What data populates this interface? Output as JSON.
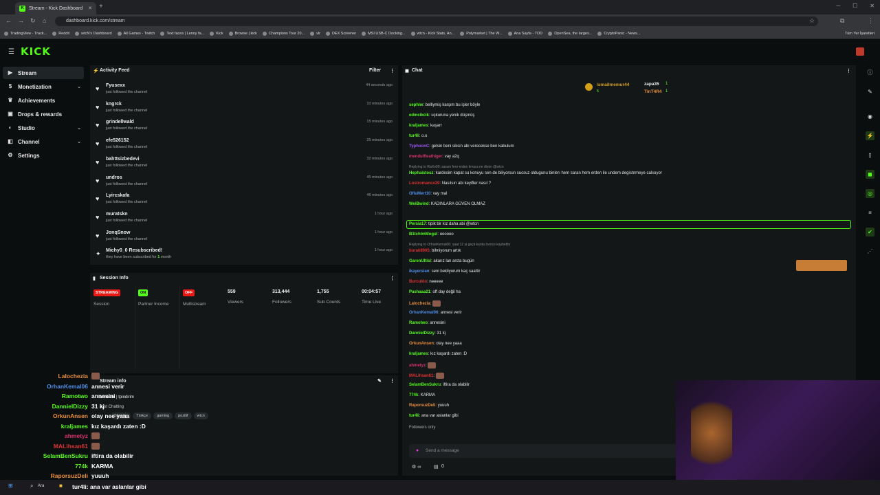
{
  "browser": {
    "tab_title": "Stream - Kick Dashboard",
    "url": "dashboard.kick.com/stream",
    "bookmarks": [
      "TradingView - Track...",
      "Reddit",
      "wtcN's Dashboard",
      "All Games - Twitch",
      "Text faces | Lenny fa...",
      "Kick",
      "Browse | kick",
      "Champions Tour 20...",
      "vlr",
      "DEX Screener",
      "MSI USB-C Docking...",
      "wtcn - Kick Stats, An...",
      "Polymarket | The W...",
      "Ana Sayfa - TOD",
      "OpenSea, the larges...",
      "CryptoPanic - News..."
    ],
    "all_bookmarks": "Tüm Yer İşaretleri"
  },
  "header": {
    "logo": "KICK"
  },
  "sidebar": {
    "items": [
      {
        "label": "Stream",
        "icon": "video-icon",
        "chevron": false,
        "active": true
      },
      {
        "label": "Monetization",
        "icon": "money-icon",
        "chevron": true
      },
      {
        "label": "Achievements",
        "icon": "trophy-icon",
        "chevron": false
      },
      {
        "label": "Drops & rewards",
        "icon": "gift-icon",
        "chevron": false
      },
      {
        "label": "Studio",
        "icon": "studio-icon",
        "chevron": true
      },
      {
        "label": "Channel",
        "icon": "channel-icon",
        "chevron": true
      },
      {
        "label": "Settings",
        "icon": "gear-icon",
        "chevron": false
      }
    ]
  },
  "activity": {
    "title": "Activity Feed",
    "filter": "Filter",
    "rows": [
      {
        "name": "Fyusexx",
        "sub": "just followed the channel",
        "time": "44 seconds ago"
      },
      {
        "name": "kngrck",
        "sub": "just followed the channel",
        "time": "10 minutes ago"
      },
      {
        "name": "grindellwald",
        "sub": "just followed the channel",
        "time": "15 minutes ago"
      },
      {
        "name": "efe526152",
        "sub": "just followed the channel",
        "time": "25 minutes ago"
      },
      {
        "name": "bahttsizbedevi",
        "sub": "just followed the channel",
        "time": "32 minutes ago"
      },
      {
        "name": "undros",
        "sub": "just followed the channel",
        "time": "45 minutes ago"
      },
      {
        "name": "Lyircskafa",
        "sub": "just followed the channel",
        "time": "46 minutes ago"
      },
      {
        "name": "muratskn",
        "sub": "just followed the channel",
        "time": "1 hour ago"
      },
      {
        "name": "JonqSnow",
        "sub": "just followed the channel",
        "time": "1 hour ago"
      },
      {
        "name": "Michy0_0 Resubscribed!",
        "sub_prefix": "they have been subscribed for ",
        "sub_num": "1",
        "sub_suffix": " month",
        "time": "1 hour ago"
      }
    ]
  },
  "session": {
    "title": "Session Info",
    "stats": [
      {
        "badge": "STREAMING",
        "badge_color": "#e91916",
        "label": "Session"
      },
      {
        "badge": "ON",
        "badge_color": "#53fc18",
        "label": "Partner Income"
      },
      {
        "badge": "OFF",
        "badge_color": "#e91916",
        "label": "Multistream"
      },
      {
        "value": "559",
        "label": "Viewers"
      },
      {
        "value": "313,444",
        "label": "Followers"
      },
      {
        "value": "1,755",
        "label": "Sub Counts"
      },
      {
        "value": "00:04:57",
        "label": "Time Live"
      }
    ]
  },
  "stream_info": {
    "title": "Stream info",
    "stream_title": "annesini | tpindirim",
    "category": "Just Chatting",
    "tags": [
      "Shooter",
      "Türkçe",
      "gaming",
      "pozitif",
      "wtcn"
    ]
  },
  "overlay_chat": [
    {
      "user": "Lalochezia",
      "color": "#e88f3d",
      "msg": ""
    },
    {
      "user": "OrhanKemal06",
      "color": "#4f8fe8",
      "msg": "annesi verir"
    },
    {
      "user": "Ramotwo",
      "color": "#53fc18",
      "msg": "annesini"
    },
    {
      "user": "DannielDizzy",
      "color": "#53fc18",
      "msg": "31 kj"
    },
    {
      "user": "OrkunAnsen",
      "color": "#e88f3d",
      "msg": "olay nee yaaa"
    },
    {
      "user": "kraljames",
      "color": "#53fc18",
      "msg": "kız kaşardı zaten :D"
    },
    {
      "user": "ahmetyz",
      "color": "#d6336c",
      "msg": ""
    },
    {
      "user": "MALihsan61",
      "color": "#e03131",
      "msg": ""
    },
    {
      "user": "SelamBenSukru",
      "color": "#53fc18",
      "msg": "iftira da olabilir"
    },
    {
      "user": "774k",
      "color": "#53fc18",
      "msg": "KARMA"
    },
    {
      "user": "RaporsuzDeli",
      "color": "#e88f3d",
      "msg": "yuuuh"
    }
  ],
  "overlay_last": "tur4li: ana var aslanlar gibi",
  "chat": {
    "title": "Chat",
    "top_users": [
      {
        "name": "ismailmemur44",
        "count": "5"
      },
      {
        "name": "zapa35",
        "count": "1"
      },
      {
        "name": "TinT4R4",
        "count": "1"
      }
    ],
    "lines": [
      {
        "type": "msg",
        "user": "sephiw",
        "color": "#53fc18",
        "text": "belliymiş karşım bu işler böyle"
      },
      {
        "type": "msg",
        "user": "edmcikcik",
        "color": "#53fc18",
        "text": "uçkuruna yenik düşmüş"
      },
      {
        "type": "msg",
        "user": "kraljames",
        "color": "#53fc18",
        "text": "kaşarr"
      },
      {
        "type": "msg",
        "user": "tur4li",
        "color": "#53fc18",
        "text": "o.o"
      },
      {
        "type": "msg",
        "user": "TyphoonC",
        "color": "#9b59f5",
        "text": "gelsin beni siksin abi verecekse ben kabulum"
      },
      {
        "type": "msg",
        "user": "mendulfleathiger",
        "color": "#d6336c",
        "text": "vay a2q"
      },
      {
        "type": "reply",
        "text": "Replying to RaXo00: saram fero erden timura ne diyon @wtcn"
      },
      {
        "type": "msg",
        "user": "Hephaistosz",
        "color": "#53fc18",
        "text": "kardesim kapat su konuyu sen de biliyorsun sucsuz oldugunu binlerı hem saran hem erden ile undem degistırmeye calısıyor"
      },
      {
        "type": "msg",
        "user": "Lostromance39",
        "color": "#e03131",
        "text": "Nasılsın abi keyifler nasıl ?"
      },
      {
        "type": "msg",
        "user": "OfluMert10",
        "color": "#4f8fe8",
        "text": "vay mal"
      },
      {
        "type": "msg",
        "user": "WeiBwind",
        "color": "#53fc18",
        "text": "KADINLARA GÜVEN OLMAZ"
      },
      {
        "type": "msg",
        "user": "Persia17",
        "color": "#53fc18",
        "text": "tipik bir kız daha abi @wtcn",
        "highlight": true
      },
      {
        "type": "msg",
        "user": "B1tchImMogul",
        "color": "#53fc18",
        "text": "oooooo"
      },
      {
        "type": "reply",
        "text": "Replying to OrhanKemal06: saat 12 yi geçti kanka bence kaybettin"
      },
      {
        "type": "msg",
        "user": "burak8905",
        "color": "#e03131",
        "text": "bilmiyorum artık"
      },
      {
        "type": "msg",
        "user": "GarenUltisi",
        "color": "#53fc18",
        "text": "akarız lan arcta bugün"
      },
      {
        "type": "msg",
        "user": "ikayersian",
        "color": "#4f8fe8",
        "text": "seni bekliyorum kaç saattir"
      },
      {
        "type": "msg",
        "user": "Burcuklo",
        "color": "#e03131",
        "text": "neeeee"
      },
      {
        "type": "msg",
        "user": "Pashaaa21",
        "color": "#53fc18",
        "text": "off day değil ha"
      },
      {
        "type": "msg",
        "user": "Lalochezia",
        "color": "#e88f3d",
        "text": ""
      },
      {
        "type": "msg",
        "user": "OrhanKemal06",
        "color": "#4f8fe8",
        "text": "annesi verir"
      },
      {
        "type": "msg",
        "user": "Ramotwo",
        "color": "#53fc18",
        "text": "annesini"
      },
      {
        "type": "msg",
        "user": "DannielDizzy",
        "color": "#53fc18",
        "text": "31 kj"
      },
      {
        "type": "msg",
        "user": "OrkunAnsen",
        "color": "#e88f3d",
        "text": "olay nee yaaa"
      },
      {
        "type": "msg",
        "user": "kraljames",
        "color": "#53fc18",
        "text": "kız kaşardı zaten :D"
      },
      {
        "type": "msg",
        "user": "ahmetyz",
        "color": "#d6336c",
        "text": ""
      },
      {
        "type": "msg",
        "user": "MALihsan61",
        "color": "#e03131",
        "text": ""
      },
      {
        "type": "msg",
        "user": "SelamBenSukru",
        "color": "#53fc18",
        "text": "iftira da olabilir"
      },
      {
        "type": "msg",
        "user": "774k",
        "color": "#53fc18",
        "text": "KARMA"
      },
      {
        "type": "msg",
        "user": "RaporsuzDeli",
        "color": "#e88f3d",
        "text": "yuuuh"
      },
      {
        "type": "msg",
        "user": "tur4li",
        "color": "#53fc18",
        "text": "ana var aslanlar gibi"
      }
    ],
    "followers_only": "Followers only",
    "input_placeholder": "Send a message",
    "points": "0"
  },
  "taskbar": {
    "search": "Ara"
  },
  "colors": {
    "accent": "#53fc18",
    "panel": "#141718",
    "bg": "#0b0e0f",
    "live": "#e91916"
  }
}
